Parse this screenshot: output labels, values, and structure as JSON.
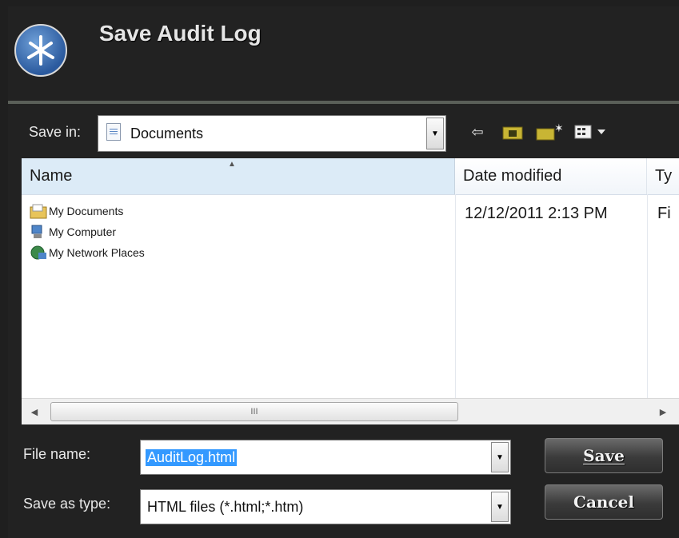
{
  "dialog": {
    "title": "Save Audit Log"
  },
  "toolbar": {
    "save_in_label": "Save in:",
    "save_in_value": "Documents",
    "icons": [
      "back-icon",
      "up-folder-icon",
      "new-folder-icon",
      "view-menu-icon"
    ]
  },
  "listview": {
    "columns": [
      "Name",
      "Date modified",
      "Ty"
    ],
    "items": [
      {
        "name": "My Documents",
        "icon": "my-documents-icon"
      },
      {
        "name": "My Computer",
        "icon": "my-computer-icon"
      },
      {
        "name": "My Network Places",
        "icon": "network-places-icon"
      }
    ],
    "first_date": "12/12/2011 2:13 PM",
    "first_type": "Fi",
    "scroll_grip": "III"
  },
  "form": {
    "file_name_label": "File name:",
    "file_name_value": "AuditLog.html",
    "save_type_label": "Save as type:",
    "save_type_value": "HTML files (*.html;*.htm)"
  },
  "buttons": {
    "save": "Save",
    "cancel": "Cancel"
  }
}
